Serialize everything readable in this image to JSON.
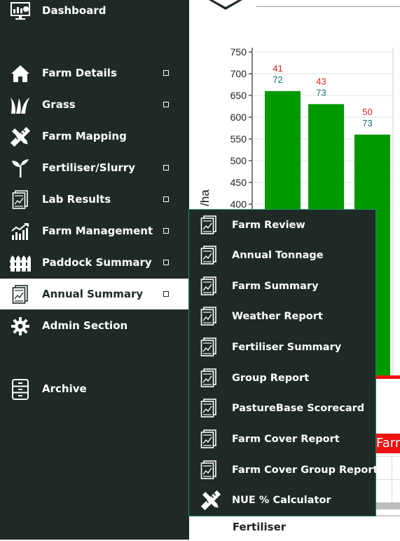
{
  "sidebar": {
    "items": [
      {
        "label": "Dashboard",
        "icon": "dashboard-icon",
        "has_arrow": false
      },
      {
        "label": "Farm Details",
        "icon": "house-icon",
        "has_arrow": true
      },
      {
        "label": "Grass",
        "icon": "grass-icon",
        "has_arrow": true
      },
      {
        "label": "Farm Mapping",
        "icon": "pencil-ruler-icon",
        "has_arrow": false
      },
      {
        "label": "Fertiliser/Slurry",
        "icon": "sprout-icon",
        "has_arrow": true
      },
      {
        "label": "Lab Results",
        "icon": "report-icon",
        "has_arrow": true
      },
      {
        "label": "Farm Management",
        "icon": "growth-chart-icon",
        "has_arrow": true
      },
      {
        "label": "Paddock Summary",
        "icon": "fence-icon",
        "has_arrow": true
      },
      {
        "label": "Annual Summary",
        "icon": "report-icon",
        "has_arrow": true,
        "active": true
      },
      {
        "label": "Admin Section",
        "icon": "gear-icon",
        "has_arrow": false
      },
      {
        "label": "Archive",
        "icon": "cabinet-icon",
        "has_arrow": false
      }
    ]
  },
  "submenu": {
    "items": [
      {
        "label": "Farm Review",
        "icon": "report-icon"
      },
      {
        "label": "Annual Tonnage",
        "icon": "report-icon"
      },
      {
        "label": "Farm Summary",
        "icon": "report-icon"
      },
      {
        "label": "Weather Report",
        "icon": "report-icon"
      },
      {
        "label": "Fertiliser Summary",
        "icon": "report-icon"
      },
      {
        "label": "Group Report",
        "icon": "report-icon"
      },
      {
        "label": "PastureBase Scorecard",
        "icon": "report-icon"
      },
      {
        "label": "Farm Cover Report",
        "icon": "report-icon"
      },
      {
        "label": "Farm Cover Group Report",
        "icon": "report-icon"
      },
      {
        "label": "NUE % Calculator",
        "icon": "pencil-ruler-icon"
      }
    ]
  },
  "chart_data": {
    "type": "bar",
    "ylabel_fragment": "/ha",
    "ytick_labels": [
      "750",
      "700",
      "650",
      "600",
      "550",
      "500",
      "450",
      "400"
    ],
    "yticks": [
      750,
      700,
      650,
      600,
      550,
      500,
      450,
      400
    ],
    "ylim": [
      400,
      750
    ],
    "values": [
      660,
      630,
      560
    ],
    "labels_top": [
      "41",
      "43",
      "50"
    ],
    "labels_bottom": [
      "72",
      "73",
      "73"
    ],
    "bar_color": "#009900",
    "label_top_color": "#dd2222",
    "label_bottom_color": "#1a6f7a"
  },
  "content": {
    "farm_tag": "Farm",
    "bottom_label": "Fertiliser"
  },
  "colors": {
    "sidebar_bg": "#1f2a27",
    "submenu_border": "#1e8a67",
    "active_bg": "#ffffff"
  }
}
